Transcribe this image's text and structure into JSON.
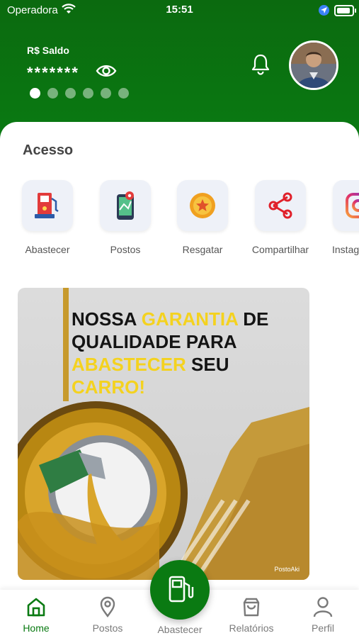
{
  "status_bar": {
    "carrier": "Operadora",
    "time": "15:51"
  },
  "header": {
    "balance_label": "R$ Saldo",
    "balance_value": "*******",
    "carousel_page": 1,
    "carousel_total": 6
  },
  "access": {
    "title": "Acesso",
    "items": [
      {
        "label": "Abastecer",
        "icon": "fuel-pump-icon"
      },
      {
        "label": "Postos",
        "icon": "map-phone-icon"
      },
      {
        "label": "Resgatar",
        "icon": "coin-icon"
      },
      {
        "label": "Compartilhar",
        "icon": "share-icon"
      },
      {
        "label": "Instagram",
        "icon": "instagram-icon"
      }
    ]
  },
  "banner": {
    "line1_a": "NOSSA ",
    "line1_b": "GARANTIA",
    "line1_c": " DE",
    "line2": "QUALIDADE PARA",
    "line3_a": "ABASTECER",
    "line3_b": " SEU ",
    "line3_c": "CARRO!",
    "brand": "PostoAki"
  },
  "nav": {
    "home": "Home",
    "postos": "Postos",
    "abastecer": "Abastecer",
    "relatorios": "Relatórios",
    "perfil": "Perfil"
  },
  "colors": {
    "primary": "#0a7a12",
    "highlight": "#f4d21f",
    "tile": "#eef1f8"
  }
}
